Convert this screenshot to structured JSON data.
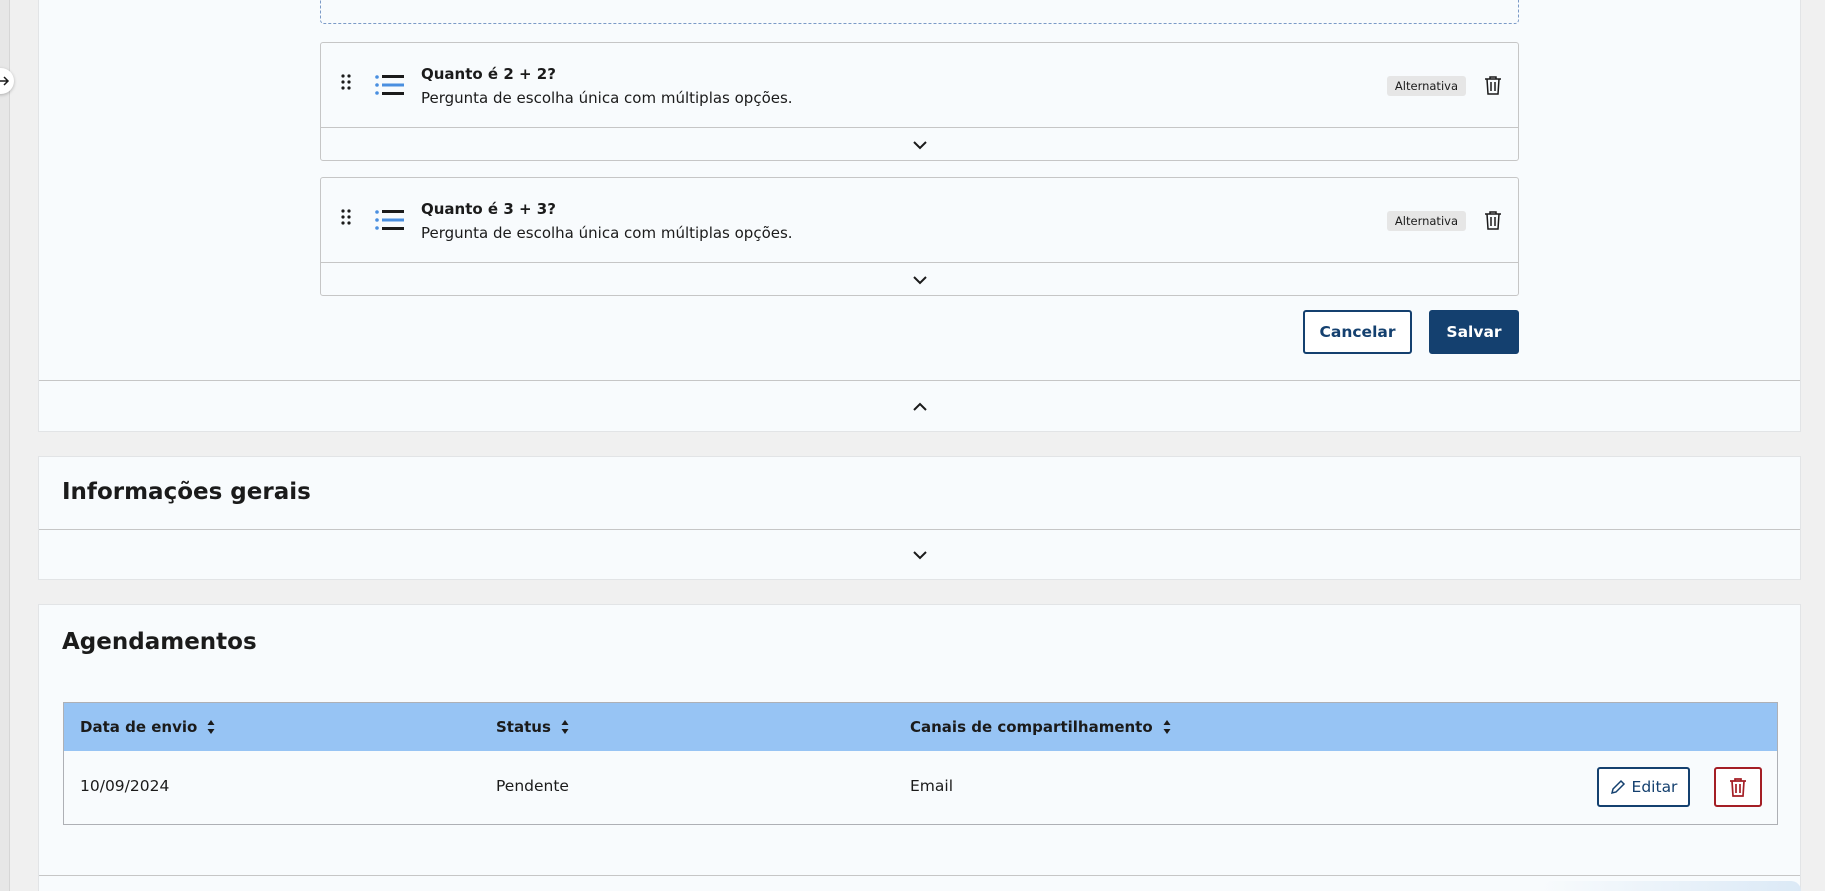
{
  "questions": [
    {
      "title": "Quanto é 2 + 2?",
      "description": "Pergunta de escolha única com múltiplas opções.",
      "type_badge": "Alternativa"
    },
    {
      "title": "Quanto é 3 + 3?",
      "description": "Pergunta de escolha única com múltiplas opções.",
      "type_badge": "Alternativa"
    }
  ],
  "actions": {
    "cancel_label": "Cancelar",
    "save_label": "Salvar"
  },
  "info_section": {
    "title": "Informações gerais"
  },
  "schedule_section": {
    "title": "Agendamentos",
    "columns": [
      "Data de envio",
      "Status",
      "Canais de compartilhamento"
    ],
    "rows": [
      {
        "date": "10/09/2024",
        "status": "Pendente",
        "channel": "Email",
        "edit_label": "Editar"
      }
    ]
  },
  "colors": {
    "primary": "#14406f",
    "header_bg": "#97c4f4",
    "danger": "#a41e25",
    "icon_blue": "#4a8fe0"
  },
  "icons": [
    "arrow-right-icon",
    "drag-handle-icon",
    "list-icon",
    "trash-icon",
    "chevron-down-icon",
    "chevron-up-icon",
    "sort-icon",
    "pencil-icon"
  ]
}
